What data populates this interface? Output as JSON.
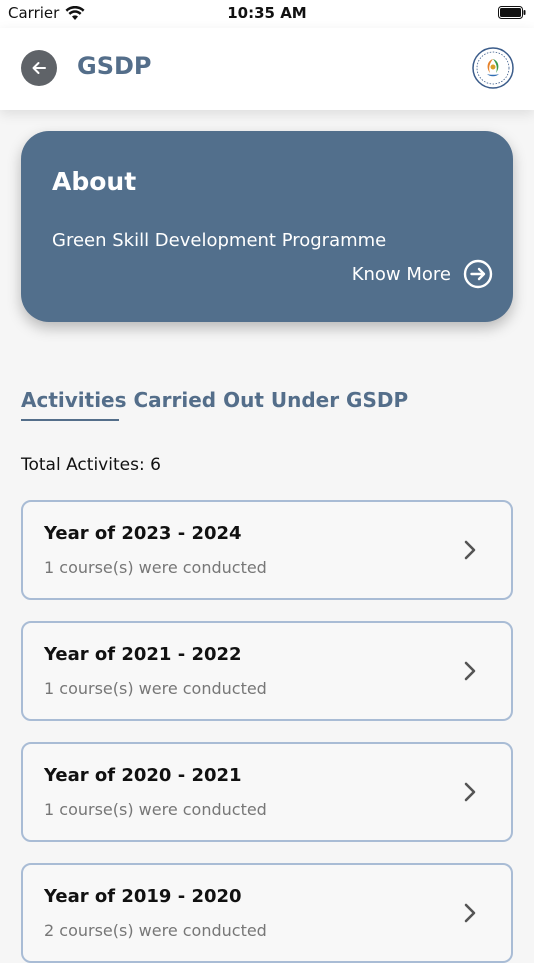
{
  "status_bar": {
    "carrier": "Carrier",
    "time": "10:35 AM"
  },
  "app_bar": {
    "title": "GSDP",
    "back_icon": "arrow-left-icon",
    "logo_icon": "gsdp-logo"
  },
  "about": {
    "title": "About",
    "description": "Green Skill Development Programme",
    "know_more_label": "Know More",
    "background_color": "#526f8c"
  },
  "activities": {
    "section_title": "Activities Carried Out Under GSDP",
    "total_label": "Total Activites: 6",
    "items": [
      {
        "year": "Year of 2023 - 2024",
        "courses": "1 course(s) were conducted"
      },
      {
        "year": "Year of 2021 - 2022",
        "courses": "1 course(s) were conducted"
      },
      {
        "year": "Year of 2020 - 2021",
        "courses": "1 course(s) were conducted"
      },
      {
        "year": "Year of 2019 - 2020",
        "courses": "2 course(s) were conducted"
      }
    ]
  },
  "colors": {
    "accent": "#546e8a",
    "card_border": "#a9bcd5",
    "background": "#f6f6f6"
  }
}
